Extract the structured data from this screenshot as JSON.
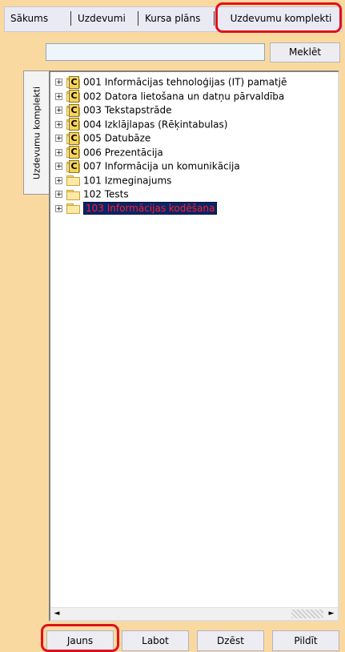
{
  "tabs": [
    {
      "label": "Sākums"
    },
    {
      "label": "Uzdevumi"
    },
    {
      "label": "Kursa plāns"
    },
    {
      "label": "Uzdevumu komplekti"
    }
  ],
  "search": {
    "value": "",
    "placeholder": "",
    "button_label": "Meklēt"
  },
  "side_tab": {
    "label": "Uzdevumu komplekti"
  },
  "tree": {
    "items": [
      {
        "label": "001 Informācijas tehnoloģijas (IT) pamatjē",
        "icon": "course-folder-icon",
        "badge": "C"
      },
      {
        "label": "002 Datora lietošana un datņu pārvaldība",
        "icon": "course-folder-icon",
        "badge": "C"
      },
      {
        "label": "003 Tekstapstrāde",
        "icon": "course-folder-icon",
        "badge": "C"
      },
      {
        "label": "004 Izklājlapas (Rēķintabulas)",
        "icon": "course-folder-icon",
        "badge": "C"
      },
      {
        "label": "005 Datubāze",
        "icon": "course-folder-icon",
        "badge": "C"
      },
      {
        "label": "006 Prezentācija",
        "icon": "course-folder-icon",
        "badge": "C"
      },
      {
        "label": "007 Informācija un komunikācija",
        "icon": "course-folder-icon",
        "badge": "C"
      },
      {
        "label": "101 Izmeginajums",
        "icon": "folder-icon"
      },
      {
        "label": "102 Tests",
        "icon": "folder-icon"
      },
      {
        "label": "103 Informācijas kodēšana",
        "icon": "folder-icon",
        "selected": true
      }
    ],
    "expander_symbol": "+"
  },
  "scrollbar": {
    "left_arrow": "◄",
    "right_arrow": "►"
  },
  "buttons": {
    "new": "Jauns",
    "edit": "Labot",
    "delete": "Dzēst",
    "fill": "Pildīt"
  },
  "colors": {
    "background": "#fad9a0",
    "highlight": "#e0101a",
    "selected_bg": "#0a246a",
    "selected_text": "#ff2020"
  }
}
